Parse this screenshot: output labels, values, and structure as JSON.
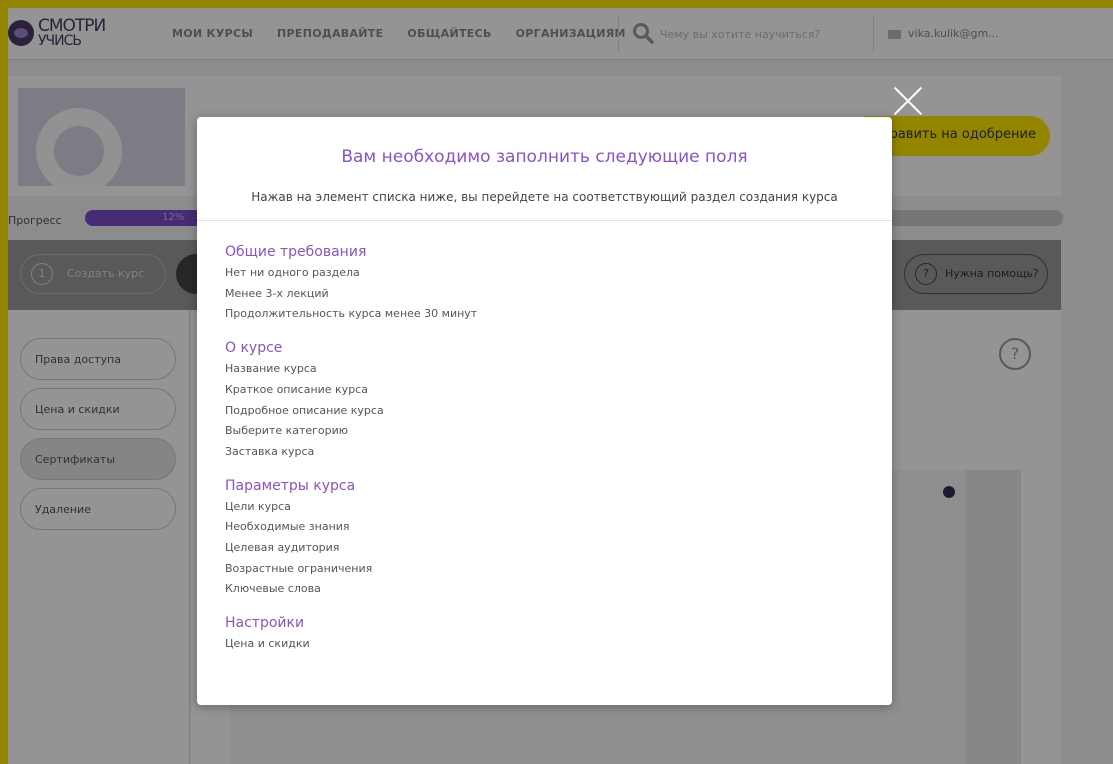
{
  "header": {
    "logo_line1": "СМОТРИ",
    "logo_line2": "УЧИСЬ",
    "nav": [
      "МОИ КУРСЫ",
      "ПРЕПОДАВАЙТЕ",
      "ОБЩАЙТЕСЬ",
      "ОРГАНИЗАЦИЯМ"
    ],
    "search_placeholder": "Чему вы хотите научиться?",
    "user_email": "vika.kulik@gm..."
  },
  "page": {
    "approve_button": "равить на одобрение",
    "progress_label": "Прогресс",
    "progress_value": "12%",
    "progress_fraction": 0.12,
    "step1_number": "1",
    "step1_label": "Создать курс",
    "help_label": "Нужна помощь?",
    "help_icon": "?",
    "sidebar": [
      "Права доступа",
      "Цена и скидки",
      "Сертификаты",
      "Удаление"
    ],
    "main_help_icon": "?"
  },
  "modal": {
    "title": "Вам необходимо заполнить следующие поля",
    "subtitle": "Нажав на элемент списка ниже, вы перейдете на соответствующий раздел создания курса",
    "sections": [
      {
        "title": "Общие требования",
        "items": [
          "Нет ни одного раздела",
          "Менее 3-х лекций",
          "Продолжительность курса менее 30 минут"
        ]
      },
      {
        "title": "О курсе",
        "items": [
          "Название курса",
          "Краткое описание курса",
          "Подробное описание курса",
          "Выберите категорию",
          "Заставка курса"
        ]
      },
      {
        "title": "Параметры курса",
        "items": [
          "Цели курса",
          "Необходимые знания",
          "Целевая аудитория",
          "Возрастные ограничения",
          "Ключевые слова"
        ]
      },
      {
        "title": "Настройки",
        "items": [
          "Цена и скидки"
        ]
      }
    ]
  },
  "colors": {
    "accent": "#8b52c9",
    "brand_yellow": "#ffe600",
    "progress": "#7b4bc9"
  }
}
